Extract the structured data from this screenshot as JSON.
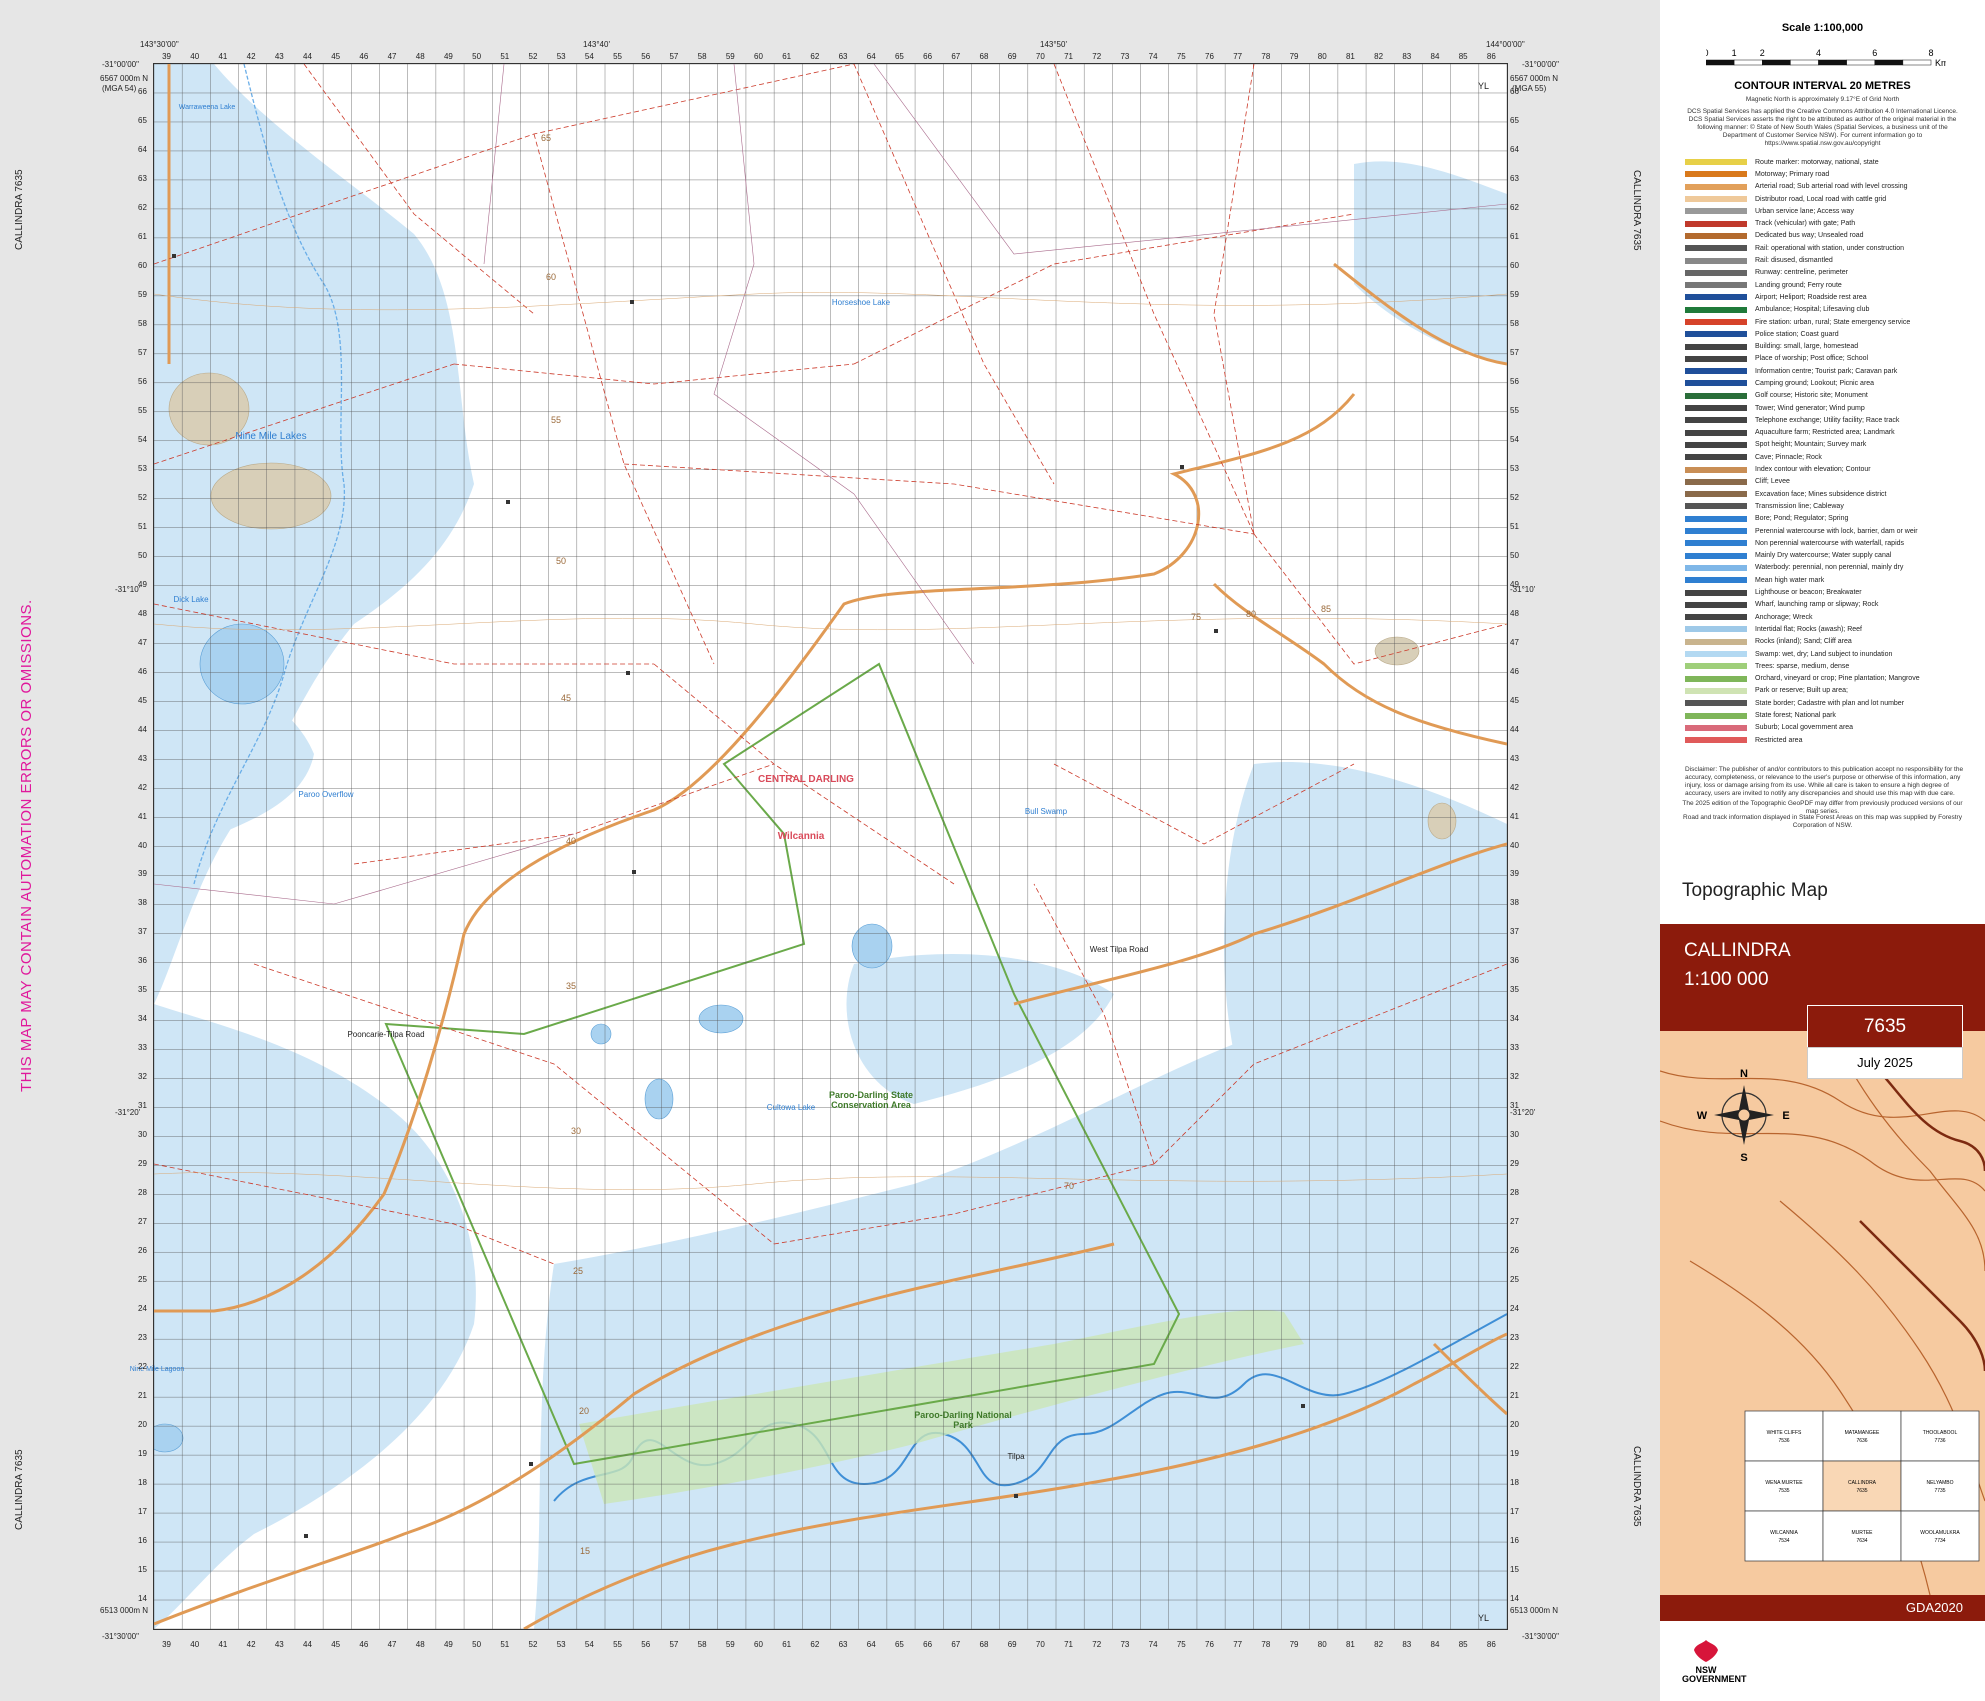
{
  "map": {
    "warning": "THIS MAP MAY CONTAIN AUTOMATION ERRORS OR OMISSIONS.",
    "adjoining_label": "CALLINDRA 7635",
    "corner_lat_top": "-31°00'00\"",
    "corner_lat_bottom": "-31°30'00\"",
    "lon_left": "143°30'00\"",
    "lon_right": "144°00'00\"",
    "lon_mid1": "143°40'",
    "lon_mid2": "143°50'",
    "lat_mid1": "-31°10'",
    "lat_mid2": "-31°20'",
    "east_ticks_top": [
      "39",
      "40",
      "41",
      "42",
      "43",
      "44",
      "45",
      "46",
      "47",
      "48",
      "49",
      "50",
      "51",
      "52",
      "53",
      "54",
      "55",
      "56",
      "57",
      "58",
      "59",
      "60",
      "61",
      "62",
      "63",
      "64",
      "65",
      "66",
      "67",
      "68",
      "69",
      "70",
      "71",
      "72",
      "73",
      "74",
      "75",
      "76",
      "77",
      "78",
      "79",
      "80",
      "81",
      "82",
      "83",
      "84",
      "85",
      "86"
    ],
    "north_ticks": [
      "66",
      "65",
      "64",
      "63",
      "62",
      "61",
      "60",
      "59",
      "58",
      "57",
      "56",
      "55",
      "54",
      "53",
      "52",
      "51",
      "50",
      "49",
      "48",
      "47",
      "46",
      "45",
      "44",
      "43",
      "42",
      "41",
      "40",
      "39",
      "38",
      "37",
      "36",
      "35",
      "34",
      "33",
      "32",
      "31",
      "30",
      "29",
      "28",
      "27",
      "26",
      "25",
      "24",
      "23",
      "22",
      "21",
      "20",
      "19",
      "18",
      "17",
      "16",
      "15",
      "14"
    ],
    "corner_north_label": "6567 000m N",
    "corner_south_label": "6513 000m N",
    "zone_label_left": "(MGA 54)",
    "zone_label_right": "(MGA 55)",
    "yl_label": "YL",
    "places": [
      {
        "name": "Nine Mile Lakes",
        "kind": "water"
      },
      {
        "name": "Dick Lake",
        "kind": "water"
      },
      {
        "name": "Horseshoe Lake",
        "kind": "water"
      },
      {
        "name": "Paroo Overflow",
        "kind": "water"
      },
      {
        "name": "Bull Swamp",
        "kind": "water"
      },
      {
        "name": "Cultowa Lake",
        "kind": "water"
      },
      {
        "name": "Nine Mile Lagoon",
        "kind": "water"
      },
      {
        "name": "Warraweena Lake",
        "kind": "water"
      },
      {
        "name": "CENTRAL DARLING",
        "kind": "lga"
      },
      {
        "name": "Wilcannia",
        "kind": "lga"
      },
      {
        "name": "Paroo-Darling State Conservation Area",
        "kind": "park"
      },
      {
        "name": "Paroo-Darling National Park",
        "kind": "park"
      },
      {
        "name": "West Tilpa Road",
        "kind": "road"
      },
      {
        "name": "Pooncarie-Tilpa Road",
        "kind": "road"
      },
      {
        "name": "Tilpa",
        "kind": "town"
      }
    ],
    "contour_labels": [
      "65",
      "60",
      "55",
      "50",
      "45",
      "40",
      "35",
      "30",
      "25",
      "20",
      "15",
      "75",
      "80",
      "85",
      "70"
    ]
  },
  "panel": {
    "scale_title": "Scale 1:100,000",
    "scale_ticks": [
      "0",
      "1",
      "2",
      "4",
      "6",
      "8"
    ],
    "scale_unit": "Km",
    "contour_interval": "CONTOUR INTERVAL 20 METRES",
    "magnetic_note": "Magnetic North is approximately 9.17°E of Grid North",
    "copyright_note": "DCS Spatial Services has applied the Creative Commons Attribution 4.0 International Licence. DCS Spatial Services asserts the right to be attributed as author of the original material in the following manner: © State of New South Wales (Spatial Services, a business unit of the Department of Customer Service NSW). For current information go to https://www.spatial.nsw.gov.au/copyright",
    "legend": [
      {
        "label": "Route marker: motorway, national, state",
        "color": "#e7d048"
      },
      {
        "label": "Motorway; Primary road",
        "color": "#d9791b"
      },
      {
        "label": "Arterial road; Sub arterial road with level crossing",
        "color": "#e2a05a"
      },
      {
        "label": "Distributor road, Local road with cattle grid",
        "color": "#efc99a"
      },
      {
        "label": "Urban service lane; Access way",
        "color": "#999999"
      },
      {
        "label": "Track (vehicular) with gate; Path",
        "color": "#c0392b"
      },
      {
        "label": "Dedicated bus way; Unsealed road",
        "color": "#b36a2e"
      },
      {
        "label": "Rail: operational with station, under construction",
        "color": "#555555"
      },
      {
        "label": "Rail: disused, dismantled",
        "color": "#888888"
      },
      {
        "label": "Runway: centreline, perimeter",
        "color": "#666666"
      },
      {
        "label": "Landing ground; Ferry route",
        "color": "#777777"
      },
      {
        "label": "Airport; Heliport; Roadside rest area",
        "color": "#1f4f9a"
      },
      {
        "label": "Ambulance; Hospital; Lifesaving club",
        "color": "#1f7a3a"
      },
      {
        "label": "Fire station: urban, rural; State emergency service",
        "color": "#d6432a"
      },
      {
        "label": "Police station; Coast guard",
        "color": "#1f4f9a"
      },
      {
        "label": "Building: small, large, homestead",
        "color": "#444444"
      },
      {
        "label": "Place of worship; Post office; School",
        "color": "#444444"
      },
      {
        "label": "Information centre; Tourist park; Caravan park",
        "color": "#1f4f9a"
      },
      {
        "label": "Camping ground; Lookout; Picnic area",
        "color": "#1f4f9a"
      },
      {
        "label": "Golf course; Historic site; Monument",
        "color": "#2a6e3a"
      },
      {
        "label": "Tower; Wind generator; Wind pump",
        "color": "#444444"
      },
      {
        "label": "Telephone exchange; Utility facility; Race track",
        "color": "#444444"
      },
      {
        "label": "Aquaculture farm; Restricted area; Landmark",
        "color": "#444444"
      },
      {
        "label": "Spot height; Mountain; Survey mark",
        "color": "#444444"
      },
      {
        "label": "Cave; Pinnacle; Rock",
        "color": "#444444"
      },
      {
        "label": "Index contour with elevation; Contour",
        "color": "#c98e55"
      },
      {
        "label": "Cliff; Levee",
        "color": "#8a6a4a"
      },
      {
        "label": "Excavation face; Mines subsidence district",
        "color": "#8a6a4a"
      },
      {
        "label": "Transmission line; Cableway",
        "color": "#555555"
      },
      {
        "label": "Bore; Pond; Regulator; Spring",
        "color": "#2f7fd1"
      },
      {
        "label": "Perennial watercourse with lock, barrier, dam or weir",
        "color": "#2f7fd1"
      },
      {
        "label": "Non perennial watercourse with waterfall, rapids",
        "color": "#2f7fd1"
      },
      {
        "label": "Mainly Dry watercourse; Water supply canal",
        "color": "#2f7fd1"
      },
      {
        "label": "Waterbody: perennial, non perennial, mainly dry",
        "color": "#7fb7e8"
      },
      {
        "label": "Mean high water mark",
        "color": "#2f7fd1"
      },
      {
        "label": "Lighthouse or beacon; Breakwater",
        "color": "#444444"
      },
      {
        "label": "Wharf, launching ramp or slipway; Rock",
        "color": "#444444"
      },
      {
        "label": "Anchorage; Wreck",
        "color": "#444444"
      },
      {
        "label": "Intertidal flat; Rocks (awash); Reef",
        "color": "#9ec9e8"
      },
      {
        "label": "Rocks (inland); Sand; Cliff area",
        "color": "#c9b48e"
      },
      {
        "label": "Swamp: wet, dry; Land subject to inundation",
        "color": "#b3d9f2"
      },
      {
        "label": "Trees: sparse, medium, dense",
        "color": "#9fcf7a"
      },
      {
        "label": "Orchard, vineyard or crop; Pine plantation; Mangrove",
        "color": "#7fb65a"
      },
      {
        "label": "Park or reserve; Built up area;",
        "color": "#cfe3b3"
      },
      {
        "label": "State border; Cadastre with plan and lot number",
        "color": "#555555"
      },
      {
        "label": "State forest; National park",
        "color": "#7fb65a"
      },
      {
        "label": "Suburb; Local government area",
        "color": "#d96a7a"
      },
      {
        "label": "Restricted area",
        "color": "#e05a5a"
      }
    ],
    "disclaimer": "Disclaimer: The publisher of and/or contributors to this publication accept no responsibility for the accuracy, completeness, or relevance to the user's purpose or otherwise of this information, any injury, loss or damage arising from its use. While all care is taken to ensure a high degree of accuracy, users are invited to notify any discrepancies and should use this map with due care.",
    "edition_note": "The 2025 edition of the Topographic GeoPDF may differ from previously produced versions of our map series.",
    "forestry_note": "Road and track information displayed in State Forest Areas on this map was supplied by Forestry Corporation of NSW.",
    "topo_title": "Topographic Map",
    "sheet_name": "CALLINDRA",
    "sheet_scale": "1:100 000",
    "sheet_number": "7635",
    "date": "July 2025",
    "datum": "GDA2020",
    "compass": {
      "n": "N",
      "s": "S",
      "e": "E",
      "w": "W"
    },
    "index_sheets": [
      {
        "name": "WHITE CLIFFS",
        "num": "7536"
      },
      {
        "name": "MATAMANGEE",
        "num": "7636"
      },
      {
        "name": "THOOLABOOL",
        "num": "7736"
      },
      {
        "name": "WENA MURTEE",
        "num": "7535"
      },
      {
        "name": "CALLINDRA",
        "num": "7635"
      },
      {
        "name": "NELYAMBO",
        "num": "7735"
      },
      {
        "name": "WILCANNIA",
        "num": "7534"
      },
      {
        "name": "MURTEE",
        "num": "7634"
      },
      {
        "name": "WOOLAMULKRA",
        "num": "7734"
      }
    ],
    "nsw_logo": "NSW GOVERNMENT",
    "colors": {
      "brand": "#8c1b0c",
      "water": "#b3d9f2",
      "road": "#e2a05a",
      "park": "#7fb65a",
      "track": "#c0392b"
    }
  }
}
